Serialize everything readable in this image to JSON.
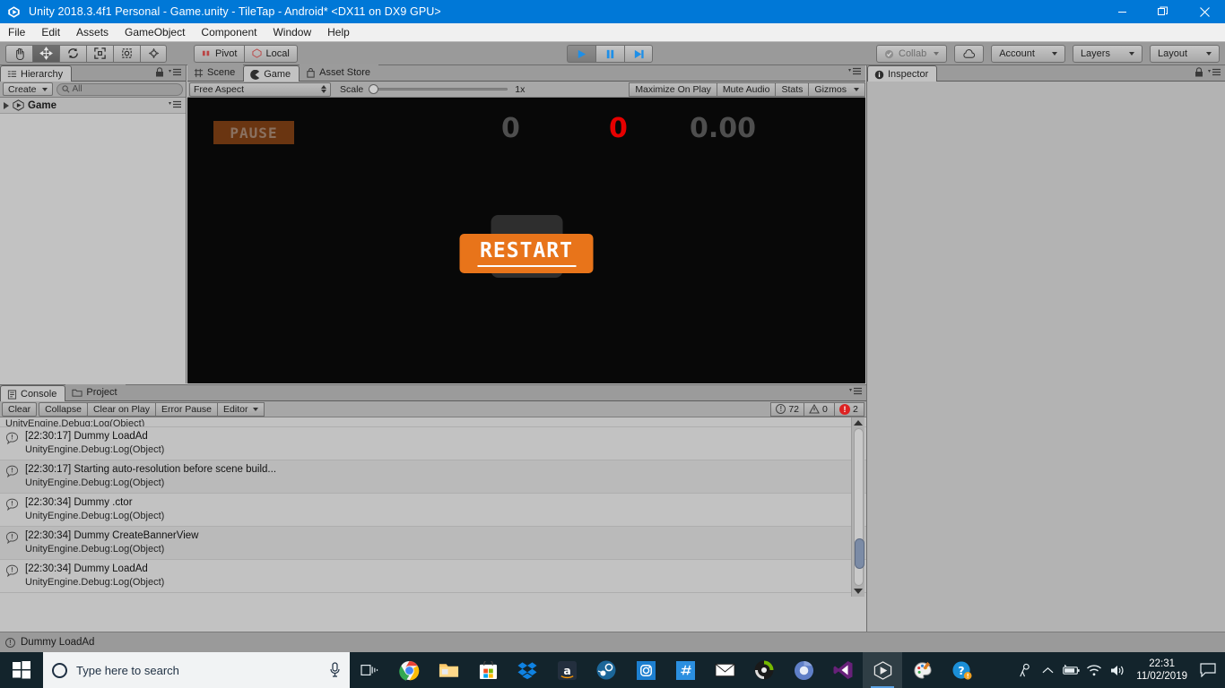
{
  "window": {
    "title": "Unity 2018.3.4f1 Personal - Game.unity - TileTap - Android* <DX11 on DX9 GPU>",
    "minimize": "—",
    "maximize": "❐",
    "close": "✕"
  },
  "menubar": {
    "items": [
      "File",
      "Edit",
      "Assets",
      "GameObject",
      "Component",
      "Window",
      "Help"
    ]
  },
  "toolbar": {
    "tools": [
      "hand-tool",
      "move-tool",
      "rotate-tool",
      "scale-tool",
      "rect-tool",
      "transform-tool"
    ],
    "active_tool_index": 1,
    "pivot_label": "Pivot",
    "local_label": "Local",
    "play_label": "play",
    "pause_label": "pause",
    "step_label": "step",
    "collab_label": "Collab",
    "cloud_label": "cloud",
    "account_label": "Account",
    "layers_label": "Layers",
    "layout_label": "Layout"
  },
  "hierarchy": {
    "tab": "Hierarchy",
    "create_label": "Create",
    "search_placeholder": "All",
    "root_item": "Game"
  },
  "gameview": {
    "tabs": [
      {
        "label": "Scene",
        "active": false
      },
      {
        "label": "Game",
        "active": true
      },
      {
        "label": "Asset Store",
        "active": false
      }
    ],
    "aspect": "Free Aspect",
    "scale_label": "Scale",
    "scale_value": "1x",
    "maximize_on_play": "Maximize On Play",
    "mute_audio": "Mute Audio",
    "stats": "Stats",
    "gizmos": "Gizmos"
  },
  "game": {
    "pause_label": "PAUSE",
    "score": "0",
    "lives": "0",
    "timer": "0.00",
    "restart_label": "RESTART",
    "colors": {
      "background": "#080808",
      "pause_bg": "#6a3511",
      "pause_text": "#8a7160",
      "score_color": "#4e4e4e",
      "lives_color": "#e60000",
      "restart_bg": "#e8741a",
      "restart_text": "#fdfdfd",
      "panel_bg": "#2e2e2e"
    }
  },
  "inspector": {
    "tab": "Inspector"
  },
  "console": {
    "tabs": [
      {
        "label": "Console",
        "active": true
      },
      {
        "label": "Project",
        "active": false
      }
    ],
    "buttons": [
      "Clear",
      "Collapse",
      "Clear on Play",
      "Error Pause",
      "Editor"
    ],
    "counts": {
      "info": "72",
      "warning": "0",
      "error": "2"
    },
    "partial_row": "UnityEngine.Debug:Log(Object)",
    "entries": [
      {
        "message": "[22:30:17] Dummy LoadAd",
        "stack": "UnityEngine.Debug:Log(Object)"
      },
      {
        "message": "[22:30:17] Starting auto-resolution before scene build...",
        "stack": "UnityEngine.Debug:Log(Object)"
      },
      {
        "message": "[22:30:34] Dummy .ctor",
        "stack": "UnityEngine.Debug:Log(Object)"
      },
      {
        "message": "[22:30:34] Dummy CreateBannerView",
        "stack": "UnityEngine.Debug:Log(Object)"
      },
      {
        "message": "[22:30:34] Dummy LoadAd",
        "stack": "UnityEngine.Debug:Log(Object)"
      }
    ]
  },
  "statusbar": {
    "message": "Dummy LoadAd"
  },
  "taskbar": {
    "search_placeholder": "Type here to search",
    "apps": [
      "task-view-icon",
      "chrome-icon",
      "file-explorer-icon",
      "microsoft-store-icon",
      "dropbox-icon",
      "amazon-icon",
      "steam-icon",
      "instagram-icon",
      "kite-icon",
      "mail-icon",
      "nvidia-icon",
      "chrome-canary-icon",
      "visual-studio-icon",
      "unity-icon",
      "paint-icon",
      "help-icon"
    ],
    "time": "22:31",
    "date": "11/02/2019"
  }
}
